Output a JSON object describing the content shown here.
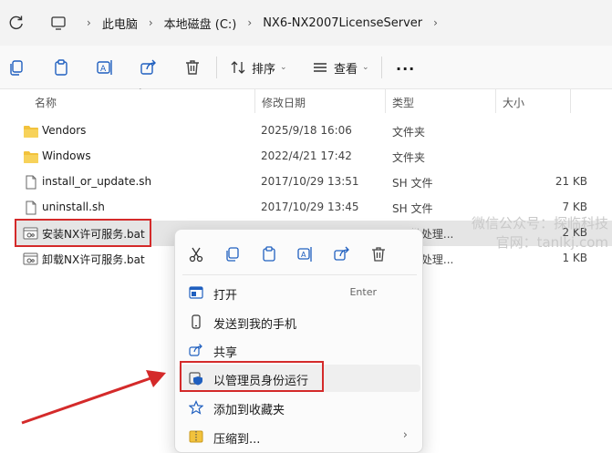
{
  "breadcrumb": {
    "items": [
      "此电脑",
      "本地磁盘 (C:)",
      "NX6-NX2007LicenseServer"
    ]
  },
  "toolbar": {
    "sort_label": "排序",
    "view_label": "查看",
    "more_label": "···"
  },
  "columns": {
    "name": "名称",
    "date": "修改日期",
    "type": "类型",
    "size": "大小"
  },
  "files": [
    {
      "name": "Vendors",
      "date": "2025/9/18 16:06",
      "type": "文件夹",
      "size": "",
      "icon": "folder-icon"
    },
    {
      "name": "Windows",
      "date": "2022/4/21 17:42",
      "type": "文件夹",
      "size": "",
      "icon": "folder-icon"
    },
    {
      "name": "install_or_update.sh",
      "date": "2017/10/29 13:51",
      "type": "SH 文件",
      "size": "21 KB",
      "icon": "file-icon"
    },
    {
      "name": "uninstall.sh",
      "date": "2017/10/29 13:45",
      "type": "SH 文件",
      "size": "7 KB",
      "icon": "file-icon"
    },
    {
      "name": "安装NX许可服务.bat",
      "date": "",
      "type": "ws 批处理...",
      "size": "2 KB",
      "icon": "bat-file-icon"
    },
    {
      "name": "卸载NX许可服务.bat",
      "date": "",
      "type": "ws 批处理...",
      "size": "1 KB",
      "icon": "bat-file-icon"
    }
  ],
  "watermark": {
    "line1": "微信公众号：探临科技",
    "line2": "官网：tanlkj.com"
  },
  "context_menu": {
    "items": [
      {
        "label": "打开",
        "shortcut": "Enter",
        "icon": "open-icon"
      },
      {
        "label": "发送到我的手机",
        "icon": "phone-icon"
      },
      {
        "label": "共享",
        "icon": "share-icon"
      },
      {
        "label": "以管理员身份运行",
        "icon": "shield-icon"
      },
      {
        "label": "添加到收藏夹",
        "icon": "star-icon"
      },
      {
        "label": "压缩到...",
        "icon": "zip-icon",
        "arrow": "›"
      }
    ]
  },
  "colors": {
    "highlight_red": "#d42a2a",
    "accent_blue": "#1f5fbf",
    "folder_yellow": "#f2c23c"
  }
}
